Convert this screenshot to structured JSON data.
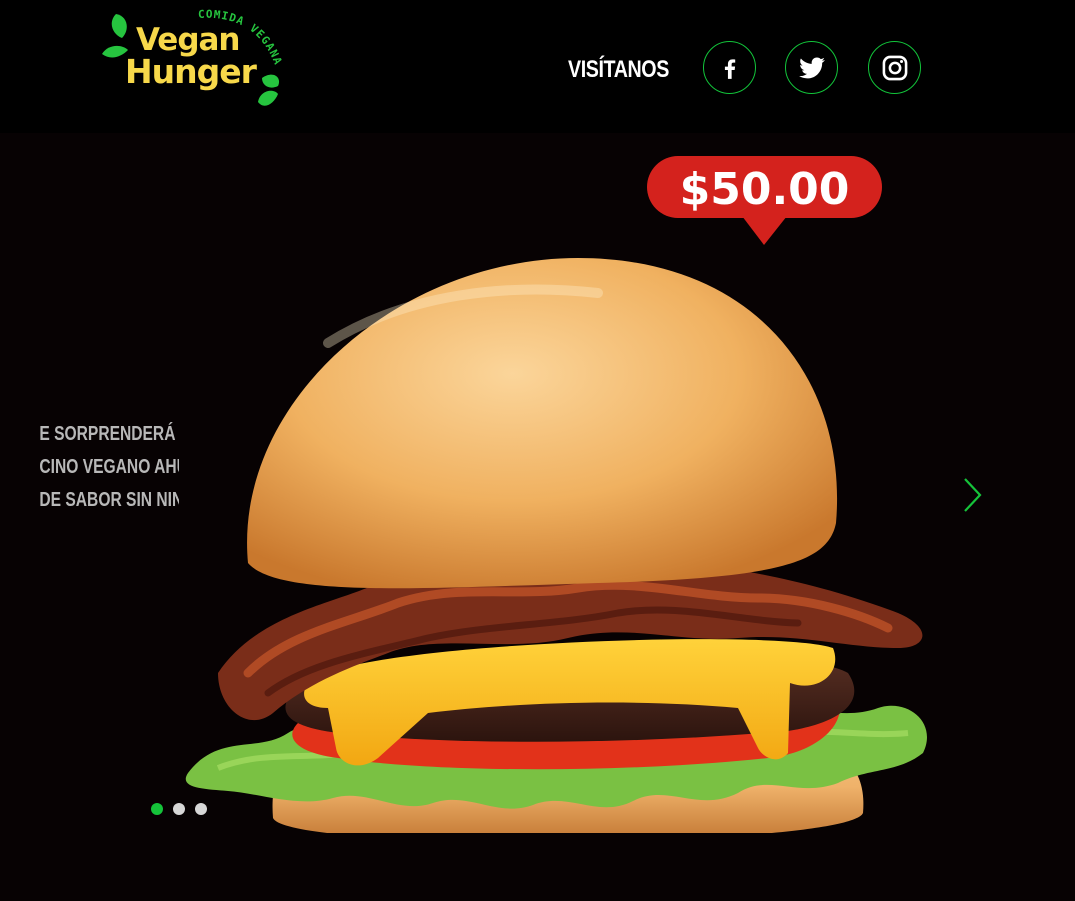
{
  "brand": {
    "name_line1": "Vegan",
    "name_line2": "Hunger",
    "tagline": "COMIDA VEGANA",
    "colors": {
      "text": "#f7d84a",
      "leaf": "#26c43f"
    }
  },
  "header": {
    "visit_label": "VISÍTANOS",
    "social": [
      {
        "name": "facebook-icon",
        "label": "Facebook"
      },
      {
        "name": "twitter-icon",
        "label": "Twitter"
      },
      {
        "name": "instagram-icon",
        "label": "Instagram"
      }
    ]
  },
  "hero": {
    "price": "$50.00",
    "description_lines": [
      "E SORPRENDERÁ CON SU",
      "CINO VEGANO AHUMADO",
      "DE SABOR SIN NINGÚN"
    ],
    "product_image": "vegan-bacon-cheeseburger",
    "slides": 3,
    "active_slide": 1
  },
  "colors": {
    "accent": "#15c33a",
    "price_badge": "#d4221d",
    "background": "#070203"
  }
}
